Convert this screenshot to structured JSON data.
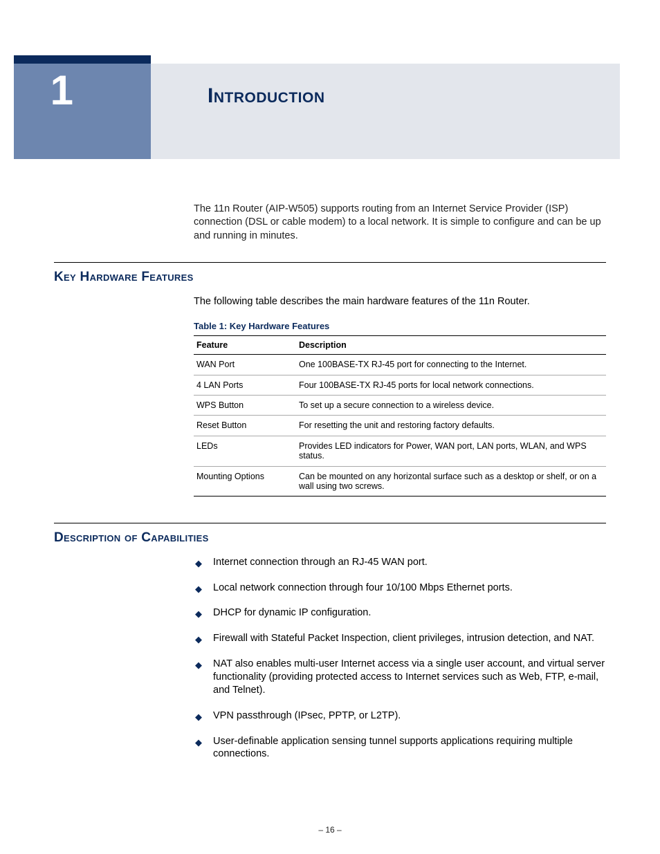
{
  "chapter": {
    "number": "1",
    "title": "Introduction"
  },
  "intro": "The 11n Router (AIP-W505) supports routing from an Internet Service Provider (ISP) connection (DSL or cable modem) to a local network. It is simple to configure and can be up and running in minutes.",
  "section_hw": {
    "title": "Key Hardware Features",
    "intro": "The following table describes the main hardware features of the 11n Router.",
    "table_caption": "Table 1: Key Hardware Features",
    "headers": {
      "feature": "Feature",
      "description": "Description"
    },
    "rows": [
      {
        "feature": "WAN Port",
        "description": "One 100BASE-TX RJ-45 port for connecting to the Internet."
      },
      {
        "feature": "4 LAN Ports",
        "description": "Four 100BASE-TX RJ-45 ports for local network connections."
      },
      {
        "feature": "WPS Button",
        "description": "To set up a secure connection to a wireless device."
      },
      {
        "feature": "Reset Button",
        "description": "For resetting the unit and restoring factory defaults."
      },
      {
        "feature": "LEDs",
        "description": "Provides LED indicators for Power, WAN port, LAN ports, WLAN, and WPS status."
      },
      {
        "feature": "Mounting Options",
        "description": "Can be mounted on any horizontal surface such as a desktop or shelf, or on a wall using two screws."
      }
    ]
  },
  "section_caps": {
    "title": "Description of Capabilities",
    "items": [
      "Internet connection through an RJ-45 WAN port.",
      "Local network connection through four 10/100 Mbps Ethernet ports.",
      "DHCP for dynamic IP configuration.",
      "Firewall with Stateful Packet Inspection, client privileges, intrusion detection, and NAT.",
      "NAT also enables multi-user Internet access via a single user account, and virtual server functionality (providing protected access to Internet services such as Web, FTP, e-mail, and Telnet).",
      "VPN passthrough (IPsec, PPTP, or L2TP).",
      "User-definable application sensing tunnel supports applications requiring multiple connections."
    ]
  },
  "page_number": "–  16  –"
}
